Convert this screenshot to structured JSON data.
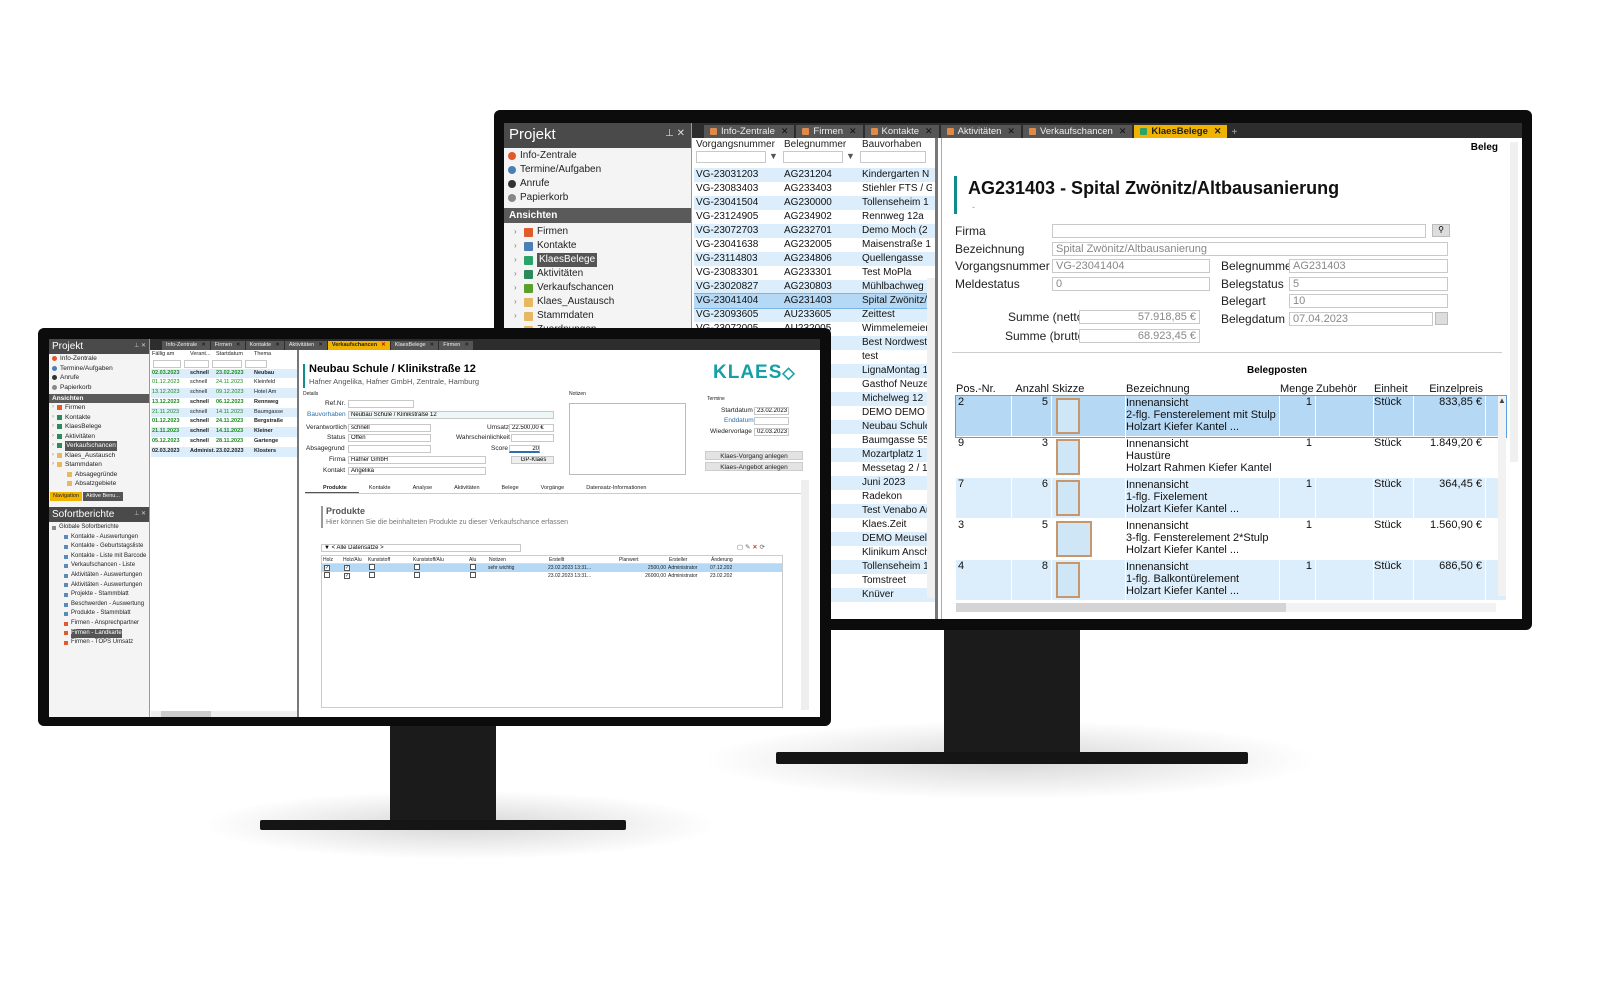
{
  "right": {
    "pane_title": "Projekt",
    "quick_items": [
      {
        "label": "Info-Zentrale",
        "icon": "info-icon"
      },
      {
        "label": "Termine/Aufgaben",
        "icon": "calendar-icon"
      },
      {
        "label": "Anrufe",
        "icon": "phone-icon"
      },
      {
        "label": "Papierkorb",
        "icon": "trash-icon"
      }
    ],
    "views_header": "Ansichten",
    "views": [
      {
        "label": "Firmen",
        "icon": "house-icon",
        "color": "#e05a2a"
      },
      {
        "label": "Kontakte",
        "icon": "people-icon",
        "color": "#4a7fb5"
      },
      {
        "label": "KlaesBelege",
        "icon": "document-icon",
        "color": "#2aa36a",
        "selected": true
      },
      {
        "label": "Aktivitäten",
        "icon": "activity-icon",
        "color": "#2a8a5a"
      },
      {
        "label": "Verkaufschancen",
        "icon": "chance-icon",
        "color": "#5aa02a"
      },
      {
        "label": "Klaes_Austausch",
        "icon": "folder-icon",
        "color": "#e8b860"
      },
      {
        "label": "Stammdaten",
        "icon": "folder-icon",
        "color": "#e8b860"
      },
      {
        "label": "Zuordnungen",
        "icon": "folder-icon",
        "color": "#e8b860"
      }
    ],
    "tabs": [
      {
        "label": "Info-Zentrale",
        "active": false
      },
      {
        "label": "Firmen",
        "active": false
      },
      {
        "label": "Kontakte",
        "active": false
      },
      {
        "label": "Aktivitäten",
        "active": false
      },
      {
        "label": "Verkaufschancen",
        "active": false
      },
      {
        "label": "KlaesBelege",
        "active": true
      }
    ],
    "list_columns": [
      "Vorgangsnummer",
      "Belegnummer",
      "Bauvorhaben"
    ],
    "list_rows": [
      [
        "VG-23031203",
        "AG231204",
        "Kindergarten N"
      ],
      [
        "VG-23083403",
        "AG233403",
        "Stiehler FTS / G"
      ],
      [
        "VG-23041504",
        "AG230000",
        "Tollenseheim 1"
      ],
      [
        "VG-23124905",
        "AG234902",
        "Rennweg 12a"
      ],
      [
        "VG-23072703",
        "AG232701",
        "Demo Moch (2"
      ],
      [
        "VG-23041638",
        "AG232005",
        "Maisenstraße 1"
      ],
      [
        "VG-23114803",
        "AG234806",
        "Quellengasse"
      ],
      [
        "VG-23083301",
        "AG233301",
        "Test MoPla"
      ],
      [
        "VG-23020827",
        "AG230803",
        "Mühlbachweg ."
      ],
      [
        "VG-23041404",
        "AG231403",
        "Spital Zwönitz/"
      ],
      [
        "VG-23093605",
        "AU233605",
        "Zeittest"
      ],
      [
        "VG-23072005",
        "AU232005",
        "Wimmelemeier"
      ],
      [
        "",
        "",
        "Best Nordwest"
      ],
      [
        "",
        "",
        "test"
      ],
      [
        "",
        "",
        "LignaMontag 1"
      ],
      [
        "",
        "",
        "Gasthof Neuzel"
      ],
      [
        "",
        "",
        "Michelweg 12"
      ],
      [
        "",
        "",
        "DEMO DEMO"
      ],
      [
        "",
        "",
        "Neubau Schule"
      ],
      [
        "",
        "",
        "Baumgasse 55"
      ],
      [
        "",
        "",
        "Mozartplatz 1"
      ],
      [
        "",
        "",
        "Messetag 2 / 1"
      ],
      [
        "",
        "",
        "Juni 2023"
      ],
      [
        "",
        "",
        "Radekon"
      ],
      [
        "",
        "",
        "Test Venabo Au"
      ],
      [
        "",
        "",
        "Klaes.Zeit"
      ],
      [
        "",
        "",
        "DEMO Meusel"
      ],
      [
        "",
        "",
        "Klinikum Ansch"
      ],
      [
        "",
        "",
        "Tollenseheim 1"
      ],
      [
        "",
        "",
        "Tomstreet"
      ],
      [
        "",
        "",
        "Knüver"
      ]
    ],
    "detail": {
      "corner_label": "Beleg",
      "title": "AG231403 - Spital Zwönitz/Altbausanierung",
      "subtitle": "-",
      "firma_label": "Firma",
      "firma_value": "",
      "bez_label": "Bezeichnung",
      "bez_value": "Spital Zwönitz/Altbausanierung",
      "vg_label": "Vorgangsnummer",
      "vg_value": "VG-23041404",
      "beleg_label": "Belegnummer",
      "beleg_value": "AG231403",
      "meld_label": "Meldestatus",
      "meld_value": "0",
      "bstat_label": "Belegstatus",
      "bstat_value": "5",
      "bart_label": "Belegart",
      "bart_value": "10",
      "netto_label": "Summe (netto)",
      "netto_value": "57.918,85 €",
      "bdat_label": "Belegdatum",
      "bdat_value": "07.04.2023",
      "brutto_label": "Summe (brutto)",
      "brutto_value": "68.923,45 €",
      "posten_title": "Belegposten",
      "posten_cols": [
        "Pos.-Nr.",
        "Anzahl",
        "Skizze",
        "Bezeichnung",
        "Menge",
        "Zubehör (#)",
        "Einheit",
        "Einzelpreis"
      ],
      "posten": [
        {
          "pos": "2",
          "anzahl": "5",
          "l1": "Innenansicht",
          "l2": "2-flg. Fensterelement mit Stulp",
          "l3": "Holzart Kiefer Kantel   ...",
          "menge": "1",
          "einheit": "Stück",
          "preis": "833,85 €"
        },
        {
          "pos": "9",
          "anzahl": "3",
          "l1": "Innenansicht",
          "l2": "Haustüre",
          "l3": "Holzart Rahmen  Kiefer Kantel",
          "menge": "1",
          "einheit": "Stück",
          "preis": "1.849,20 €"
        },
        {
          "pos": "7",
          "anzahl": "6",
          "l1": "Innenansicht",
          "l2": "1-flg. Fixelement",
          "l3": "Holzart Kiefer Kantel   ...",
          "menge": "1",
          "einheit": "Stück",
          "preis": "364,45 €"
        },
        {
          "pos": "3",
          "anzahl": "5",
          "l1": "Innenansicht",
          "l2": "3-flg. Fensterelement 2*Stulp",
          "l3": "Holzart Kiefer Kantel   ...",
          "menge": "1",
          "einheit": "Stück",
          "preis": "1.560,90 €"
        },
        {
          "pos": "4",
          "anzahl": "8",
          "l1": "Innenansicht",
          "l2": "1-flg. Balkontürelement",
          "l3": "Holzart Kiefer Kantel   ...",
          "menge": "1",
          "einheit": "Stück",
          "preis": "686,50 €"
        }
      ]
    }
  },
  "left": {
    "pane_title": "Projekt",
    "quick_items": [
      "Info-Zentrale",
      "Termine/Aufgaben",
      "Anrufe",
      "Papierkorb"
    ],
    "views_header": "Ansichten",
    "views": [
      "Firmen",
      "Kontakte",
      "KlaesBelege",
      "Aktivitäten",
      "Verkaufschancen",
      "Klaes_Austausch",
      "Stammdaten",
      "Absagegründe",
      "Absatzgebiete"
    ],
    "nav_tabs": [
      "Navigation",
      "Aktive Benu..."
    ],
    "reports_title": "Sofortberichte",
    "reports": [
      "Globale Sofortberichte",
      "Kontakte - Auswertungen",
      "Kontakte - Geburtstagsliste",
      "Kontakte - Liste mit Barcode",
      "Verkaufschancen - Liste",
      "Aktivitäten - Auswertungen",
      "Aktivitäten - Auswertungen",
      "Projekte - Stammblatt",
      "Beschwerden - Auswertung",
      "Produkte - Stammblatt",
      "Firmen - Ansprechpartner",
      "Firmen - Landkarte",
      "Firmen - TOPS Umsatz"
    ],
    "tabs": [
      {
        "label": "Info-Zentrale",
        "active": false
      },
      {
        "label": "Firmen",
        "active": false
      },
      {
        "label": "Kontakte",
        "active": false
      },
      {
        "label": "Aktivitäten",
        "active": false
      },
      {
        "label": "Verkaufschancen",
        "active": true
      },
      {
        "label": "KlaesBelege",
        "active": false
      },
      {
        "label": "Firmen",
        "active": false
      }
    ],
    "list_columns": [
      "Fällig am",
      "Verant...",
      "Startdatum",
      "Thema"
    ],
    "list_rows": [
      [
        "02.03.2023",
        "schnell",
        "23.02.2023",
        "Neubau"
      ],
      [
        "01.12.2023",
        "schnell",
        "24.11.2023",
        "Kleinfeld"
      ],
      [
        "13.12.2023",
        "schnell",
        "09.12.2023",
        "Hotel Am"
      ],
      [
        "13.12.2023",
        "schnell",
        "06.12.2023",
        "Rennweg"
      ],
      [
        "21.11.2023",
        "schnell",
        "14.11.2023",
        "Baumgasse"
      ],
      [
        "01.12.2023",
        "schnell",
        "24.11.2023",
        "Bergstraße"
      ],
      [
        "21.11.2023",
        "schnell",
        "14.11.2023",
        "Kleiner"
      ],
      [
        "05.12.2023",
        "schnell",
        "28.11.2023",
        "Gartenge"
      ],
      [
        "02.03.2023",
        "Administ...",
        "23.02.2023",
        "Klosters"
      ]
    ],
    "detail": {
      "title": "Neubau Schule / Klinikstraße 12",
      "subtitle": "Hafner Angelika, Hafner GmbH, Zentrale, Hamburg",
      "logo": "KLAES",
      "section_label": "Details",
      "notes_label": "Notizen",
      "dates_label": "Termine",
      "refnr_label": "Ref.Nr.",
      "refnr_value": "",
      "bauv_label": "Bauvorhaben",
      "bauv_value": "Neubau Schule / Klinikstraße 12",
      "verant_label": "Verantwortlich",
      "verant_value": "schnell",
      "umsatz_label": "Umsatz",
      "umsatz_value": "22.500,00 €",
      "status_label": "Status",
      "status_value": "Offen",
      "wahrsch_label": "Wahrscheinlichkeit",
      "absage_label": "Absagegrund",
      "score_label": "Score",
      "score_value": "20",
      "firma_label": "Firma",
      "firma_value": "Hafner GmbH",
      "gp_button": "GP-Klaes",
      "kontakt_label": "Kontakt",
      "kontakt_value": "Angelika",
      "start_label": "Startdatum",
      "start_value": "23.02.2023",
      "end_label": "Enddatum",
      "end_value": "",
      "wv_label": "Wiedervorlage",
      "wv_value": "02.03.2023",
      "btn_vorgang": "Klaes-Vorgang anlegen",
      "btn_angebot": "Klaes-Angebot anlegen",
      "subtabs": [
        "Produkte",
        "Kontakte",
        "Analyse",
        "Aktivitäten",
        "Belege",
        "Vorgänge",
        "Datensatz-Informationen"
      ],
      "produkte_title": "Produkte",
      "produkte_hint": "Hier können Sie die beinhalteten Produkte zu dieser Verkaufschance erfassen",
      "filter_value": "< Alle Datensätze >",
      "prod_cols": [
        "Holz",
        "Holz/Alu",
        "Kunststoff",
        "Kunststoff/Alu",
        "Alu",
        "Notizen",
        "Erstellt",
        "Planwert",
        "Ersteller",
        "Änderung"
      ],
      "prod_rows": [
        {
          "notiz": "sehr wichtig",
          "erstellt": "23.02.2023 13:31...",
          "plan": "2500,00",
          "ersteller": "Administrator",
          "aend": "07.12.202"
        },
        {
          "notiz": "",
          "erstellt": "23.02.2023 13:31...",
          "plan": "26000,00",
          "ersteller": "Administrator",
          "aend": "23.02.202"
        }
      ]
    }
  }
}
